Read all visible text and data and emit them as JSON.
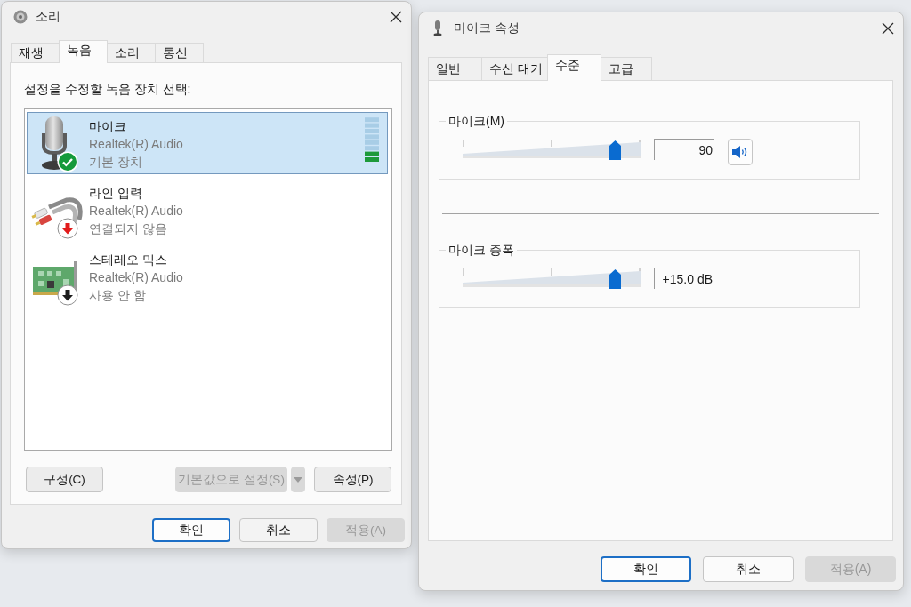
{
  "sound_dialog": {
    "title": "소리",
    "tabs": [
      {
        "label": "재생",
        "selected": false
      },
      {
        "label": "녹음",
        "selected": true
      },
      {
        "label": "소리",
        "selected": false
      },
      {
        "label": "통신",
        "selected": false
      }
    ],
    "instruction": "설정을 수정할 녹음 장치 선택:",
    "devices": [
      {
        "kind": "microphone",
        "name": "마이크",
        "driver": "Realtek(R) Audio",
        "status": "기본 장치",
        "default_device": true,
        "plugged_in": true,
        "enabled": true,
        "selected": true,
        "level": 0.25
      },
      {
        "kind": "line-in",
        "name": "라인 입력",
        "driver": "Realtek(R) Audio",
        "status": "연결되지 않음",
        "default_device": false,
        "plugged_in": false,
        "enabled": true,
        "selected": false
      },
      {
        "kind": "stereo-mix",
        "name": "스테레오 믹스",
        "driver": "Realtek(R) Audio",
        "status": "사용 안 함",
        "default_device": false,
        "plugged_in": true,
        "enabled": false,
        "selected": false
      }
    ],
    "device_buttons": [
      {
        "kind": "plain",
        "label": "구성(C)",
        "disabled": false
      },
      {
        "kind": "split",
        "label": "기본값으로 설정(S)",
        "disabled": true
      },
      {
        "kind": "plain",
        "label": "속성(P)",
        "disabled": false
      }
    ],
    "footer_buttons": [
      {
        "label": "확인",
        "default": true,
        "disabled": false
      },
      {
        "label": "취소",
        "default": false,
        "disabled": false
      },
      {
        "label": "적용(A)",
        "default": false,
        "disabled": true
      }
    ]
  },
  "properties_dialog": {
    "title": "마이크 속성",
    "tabs": [
      {
        "label": "일반",
        "selected": false
      },
      {
        "label": "수신 대기",
        "selected": false
      },
      {
        "label": "수준",
        "selected": true
      },
      {
        "label": "고급",
        "selected": false
      }
    ],
    "groups": [
      {
        "kind": "volume",
        "label": "마이크(M)",
        "level": 0.88,
        "reading": "90",
        "muted": false
      },
      {
        "kind": "boost",
        "label": "마이크 증폭",
        "level": 0.88,
        "reading": "+15.0 dB"
      }
    ],
    "footer_buttons": [
      {
        "label": "확인",
        "default": true,
        "disabled": false
      },
      {
        "label": "취소",
        "default": false,
        "disabled": false
      },
      {
        "label": "적용(A)",
        "default": false,
        "disabled": true
      }
    ]
  }
}
